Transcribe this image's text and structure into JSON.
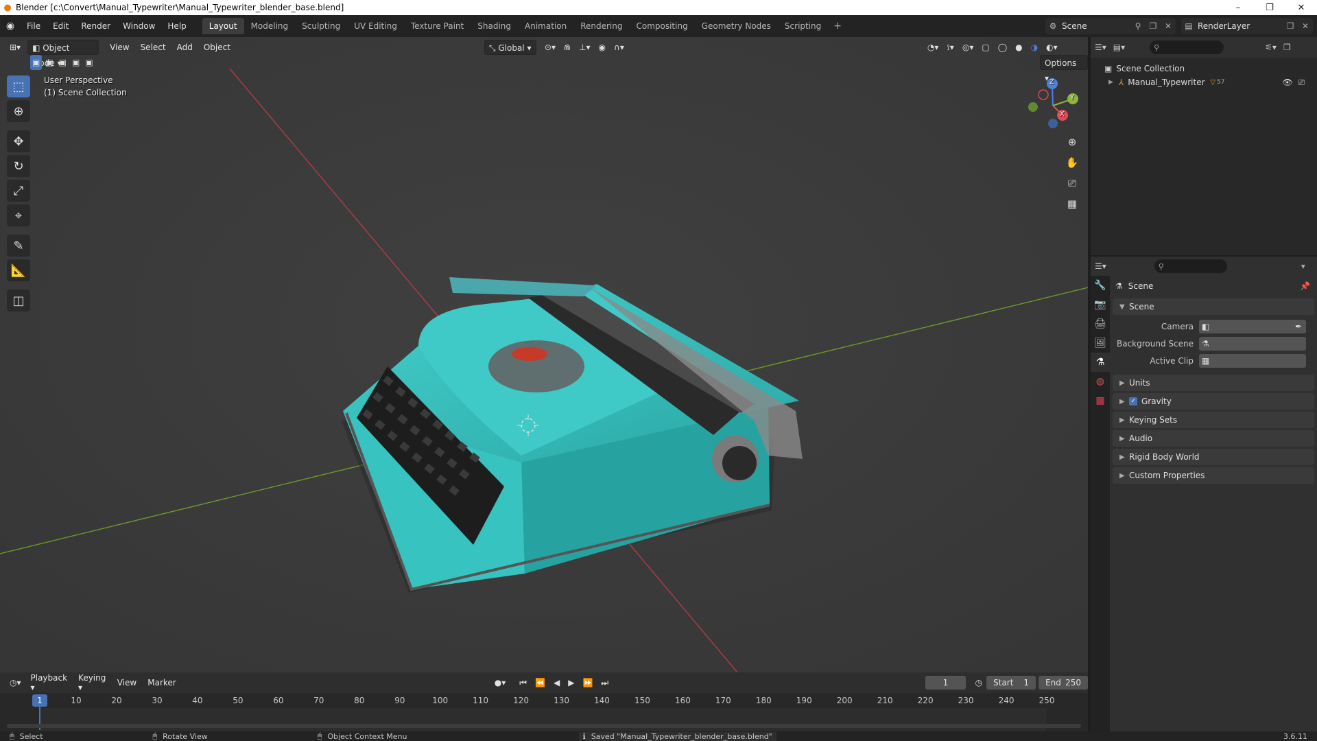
{
  "window": {
    "title": "Blender [c:\\Convert\\Manual_Typewriter\\Manual_Typewriter_blender_base.blend]",
    "minimize": "–",
    "maximize": "❐",
    "close": "✕"
  },
  "menu": {
    "items": [
      "File",
      "Edit",
      "Render",
      "Window",
      "Help"
    ],
    "workspaces": [
      "Layout",
      "Modeling",
      "Sculpting",
      "UV Editing",
      "Texture Paint",
      "Shading",
      "Animation",
      "Rendering",
      "Compositing",
      "Geometry Nodes",
      "Scripting"
    ],
    "active_workspace": "Layout",
    "add": "+",
    "scene": "Scene",
    "view_layer": "RenderLayer"
  },
  "viewport": {
    "mode": "Object Mode",
    "menus": [
      "View",
      "Select",
      "Add",
      "Object"
    ],
    "transform_orientation": "Global",
    "options": "Options",
    "overlay_line1": "User Perspective",
    "overlay_line2": "(1) Scene Collection",
    "gizmo": {
      "x": "X",
      "y": "Y",
      "z": "Z"
    },
    "colors": {
      "background": "#3a3a3a",
      "x_axis": "#c4404c",
      "y_axis": "#7aa52e",
      "typewriter": "#3cc4c2"
    }
  },
  "outliner": {
    "root": "Scene Collection",
    "child": "Manual_Typewriter",
    "child_badge": "57"
  },
  "properties": {
    "context": "Scene",
    "section": "Scene",
    "camera_label": "Camera",
    "background_scene_label": "Background Scene",
    "active_clip_label": "Active Clip",
    "panels": [
      "Units",
      "Gravity",
      "Keying Sets",
      "Audio",
      "Rigid Body World",
      "Custom Properties"
    ],
    "gravity_checked": true
  },
  "timeline": {
    "menus": [
      "Playback",
      "Keying",
      "View",
      "Marker"
    ],
    "current_frame": "1",
    "start_label": "Start",
    "start": "1",
    "end_label": "End",
    "end": "250",
    "ruler": [
      "1",
      "10",
      "20",
      "30",
      "40",
      "50",
      "60",
      "70",
      "80",
      "90",
      "100",
      "110",
      "120",
      "130",
      "140",
      "150",
      "160",
      "170",
      "180",
      "190",
      "200",
      "210",
      "220",
      "230",
      "240",
      "250"
    ]
  },
  "status": {
    "select": "Select",
    "rotate": "Rotate View",
    "context_menu": "Object Context Menu",
    "message": "Saved \"Manual_Typewriter_blender_base.blend\"",
    "version": "3.6.11"
  }
}
